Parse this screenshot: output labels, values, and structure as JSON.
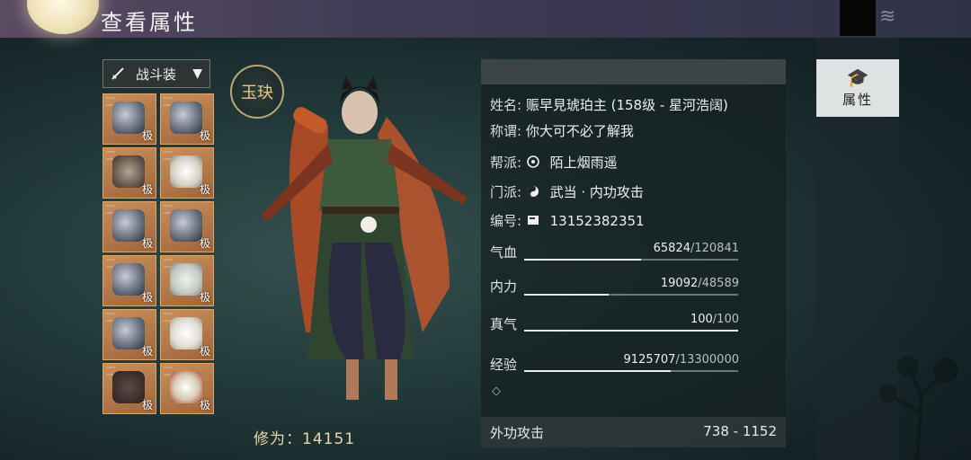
{
  "header": {
    "title": "查看属性"
  },
  "outfit": {
    "label": "战斗装",
    "icon": "sword-icon"
  },
  "equipment": [
    {
      "slot": "weapon-main",
      "grade": "极"
    },
    {
      "slot": "weapon-off",
      "grade": "极"
    },
    {
      "slot": "head",
      "grade": "极"
    },
    {
      "slot": "jade",
      "grade": "极"
    },
    {
      "slot": "chest",
      "grade": "极"
    },
    {
      "slot": "bracers",
      "grade": "极"
    },
    {
      "slot": "shoulder",
      "grade": "极"
    },
    {
      "slot": "bracelet",
      "grade": "极"
    },
    {
      "slot": "belt",
      "grade": "极"
    },
    {
      "slot": "ring",
      "grade": "极"
    },
    {
      "slot": "boots",
      "grade": "极"
    },
    {
      "slot": "pendant",
      "grade": "极"
    }
  ],
  "emblem": {
    "text": "玉玦"
  },
  "cultivation": {
    "text": "修为：14151"
  },
  "profile": {
    "name_label": "姓名:",
    "name_value": "赈早見琥珀主 (158级 - 星河浩阔)",
    "title_label": "称谓:",
    "title_value": "你大可不必了解我",
    "guild_label": "帮派:",
    "guild_value": "陌上烟雨遥",
    "sect_label": "门派:",
    "sect_value": "武当 · 内功攻击",
    "id_label": "编号:",
    "id_value": "13152382351"
  },
  "stats": [
    {
      "label": "气血",
      "current": "65824",
      "max": "/120841",
      "ratio": 0.545
    },
    {
      "label": "内力",
      "current": "19092",
      "max": "/48589",
      "ratio": 0.393
    },
    {
      "label": "真气",
      "current": "100",
      "max": "/100",
      "ratio": 1.0
    },
    {
      "label": "经验",
      "current": "9125707",
      "max": "/13300000",
      "ratio": 0.686
    }
  ],
  "attack": {
    "label": "外功攻击",
    "value": "738 - 1152"
  },
  "tabs": {
    "attributes": "属性"
  },
  "colors": {
    "slot_bg": "#b87a48",
    "bar_fill": "#e8eef0",
    "panel_header": "#3c4546"
  }
}
